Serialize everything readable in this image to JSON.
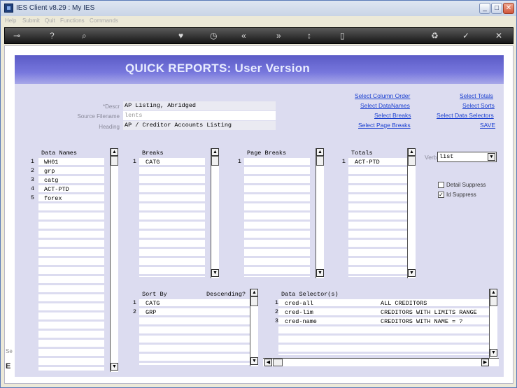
{
  "window": {
    "title": "IES Client v8.29 : My IES"
  },
  "menu": [
    "Help",
    "Submit",
    "Quit",
    "Functions",
    "Commands"
  ],
  "page": {
    "title": "QUICK REPORTS: User Version"
  },
  "form": {
    "descr_label": "*Descr",
    "descr_value": "AP Listing, Abridged",
    "source_label": "Source Filename",
    "source_value": "lents",
    "heading_label": "Heading",
    "heading_value": "AP / Creditor Accounts Listing"
  },
  "links_mid": [
    "Select Column Order",
    "Select DataNames",
    "Select Breaks",
    "Select Page Breaks"
  ],
  "links_right": [
    "Select Totals",
    "Select Sorts",
    "Select Data Selectors",
    "SAVE"
  ],
  "data_names": {
    "header": "Data Names",
    "items": [
      "WH01",
      "grp",
      "catg",
      "ACT-PTD",
      "forex"
    ]
  },
  "breaks": {
    "header": "Breaks",
    "items": [
      "CATG"
    ]
  },
  "page_breaks": {
    "header": "Page Breaks",
    "items": [
      ""
    ]
  },
  "totals": {
    "header": "Totals",
    "items": [
      "ACT-PTD"
    ]
  },
  "verb": {
    "label": "Verb",
    "value": "list"
  },
  "options": {
    "detail_suppress": "Detail Suppress",
    "id_suppress": "Id Suppress"
  },
  "sort_by": {
    "header": "Sort By",
    "desc_header": "Descending?",
    "items": [
      "CATG",
      "GRP"
    ]
  },
  "data_selectors": {
    "header": "Data Selector(s)",
    "items": [
      {
        "name": "cred-all",
        "desc": "ALL CREDITORS"
      },
      {
        "name": "cred-lim",
        "desc": "CREDITORS WITH LIMITS RANGE"
      },
      {
        "name": "cred-name",
        "desc": "CREDITORS WITH NAME = ?"
      }
    ]
  },
  "side_stub": {
    "text1": "Se",
    "text2": "E"
  }
}
